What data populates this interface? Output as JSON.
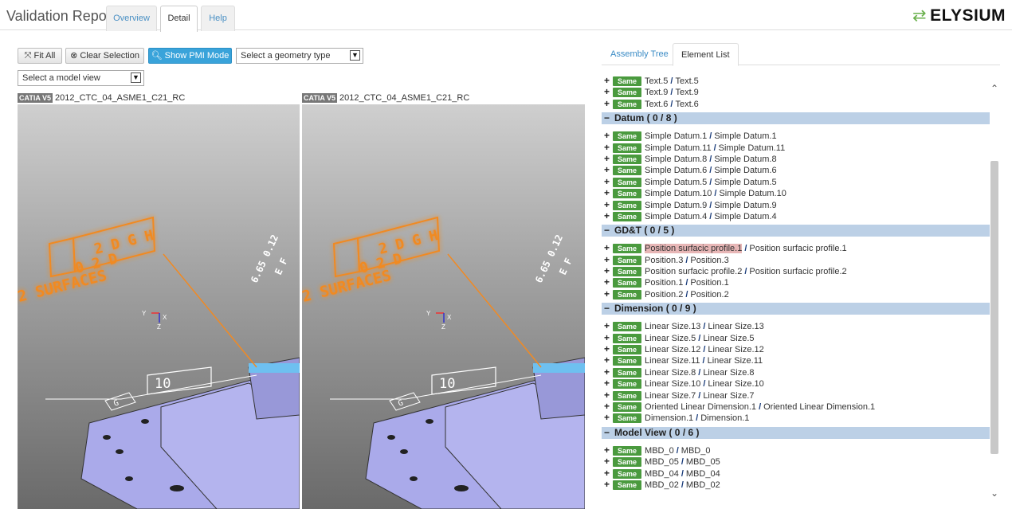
{
  "header": {
    "title": "Validation Report",
    "tabs": [
      "Overview",
      "Detail",
      "Help"
    ],
    "active_tab": "Detail",
    "logo_text": "ELYSIUM"
  },
  "toolbar": {
    "fit_all": "Fit All",
    "clear_selection": "Clear Selection",
    "show_pmi": "Show PMI Mode",
    "geometry_select": "Select a geometry type",
    "model_view_select": "Select a model view"
  },
  "viewports": [
    {
      "badge": "CATIA V5",
      "name": "2012_CTC_04_ASME1_C21_RC"
    },
    {
      "badge": "CATIA V5",
      "name": "2012_CTC_04_ASME1_C21_RC"
    }
  ],
  "model_labels": {
    "fcf_row1": "2 D G H",
    "fcf_row2": "0 2 D",
    "surfaces": "2 SURFACES",
    "dim": "10",
    "axis_y": "Y",
    "axis_x": "X",
    "axis_z": "Z",
    "datum_tag": "G",
    "rot_text": "6.65 0.12",
    "rot_fcf": "E F"
  },
  "right_panel": {
    "tabs": [
      "Assembly Tree",
      "Element List"
    ],
    "active_tab": "Element List",
    "status_label": "Same",
    "top_rows": [
      [
        "Text.5",
        "Text.5"
      ],
      [
        "Text.9",
        "Text.9"
      ],
      [
        "Text.6",
        "Text.6"
      ]
    ],
    "groups": [
      {
        "title": "Datum ( 0 / 8 )",
        "rows": [
          [
            "Simple Datum.1",
            "Simple Datum.1"
          ],
          [
            "Simple Datum.11",
            "Simple Datum.11"
          ],
          [
            "Simple Datum.8",
            "Simple Datum.8"
          ],
          [
            "Simple Datum.6",
            "Simple Datum.6"
          ],
          [
            "Simple Datum.5",
            "Simple Datum.5"
          ],
          [
            "Simple Datum.10",
            "Simple Datum.10"
          ],
          [
            "Simple Datum.9",
            "Simple Datum.9"
          ],
          [
            "Simple Datum.4",
            "Simple Datum.4"
          ]
        ]
      },
      {
        "title": "GD&T ( 0 / 5 )",
        "rows": [
          [
            "Position surfacic profile.1",
            "Position surfacic profile.1"
          ],
          [
            "Position.3",
            "Position.3"
          ],
          [
            "Position surfacic profile.2",
            "Position surfacic profile.2"
          ],
          [
            "Position.1",
            "Position.1"
          ],
          [
            "Position.2",
            "Position.2"
          ]
        ]
      },
      {
        "title": "Dimension ( 0 / 9 )",
        "rows": [
          [
            "Linear Size.13",
            "Linear Size.13"
          ],
          [
            "Linear Size.5",
            "Linear Size.5"
          ],
          [
            "Linear Size.12",
            "Linear Size.12"
          ],
          [
            "Linear Size.11",
            "Linear Size.11"
          ],
          [
            "Linear Size.8",
            "Linear Size.8"
          ],
          [
            "Linear Size.10",
            "Linear Size.10"
          ],
          [
            "Linear Size.7",
            "Linear Size.7"
          ],
          [
            "Oriented Linear Dimension.1",
            "Oriented Linear Dimension.1"
          ],
          [
            "Dimension.1",
            "Dimension.1"
          ]
        ]
      },
      {
        "title": "Model View ( 0 / 6 )",
        "rows": [
          [
            "MBD_0",
            "MBD_0"
          ],
          [
            "MBD_05",
            "MBD_05"
          ],
          [
            "MBD_04",
            "MBD_04"
          ],
          [
            "MBD_02",
            "MBD_02"
          ]
        ]
      }
    ],
    "highlighted": "Position surfacic profile.1"
  },
  "colors": {
    "accent": "#39a3da",
    "same_badge": "#4a9a3e",
    "group_header": "#bcd0e6",
    "pmi_orange": "#f08a24",
    "model_face": "#a9a9e0"
  }
}
